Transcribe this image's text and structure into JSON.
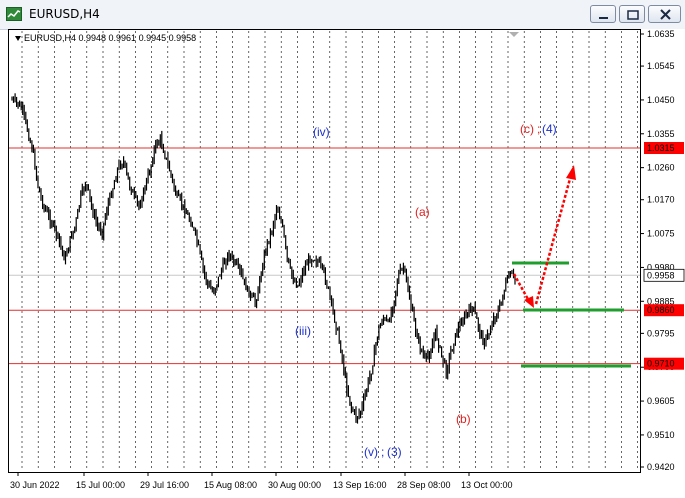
{
  "window": {
    "title": "EURUSD,H4",
    "buttons": {
      "minimize": "minimize",
      "maximize": "maximize",
      "close": "close"
    }
  },
  "header": {
    "symbol_info": "EURUSD,H4  0.9948 0.9961 0.9945 0.9958"
  },
  "price_axis": {
    "ticks": [
      "1.0635",
      "1.0545",
      "1.0450",
      "1.0355",
      "1.0260",
      "1.0170",
      "1.0075",
      "0.9980",
      "0.9885",
      "0.9795",
      "0.9700",
      "0.9605",
      "0.9510",
      "0.9420"
    ],
    "current_price": "0.9958",
    "level_markers": [
      "1.0315",
      "0.9860",
      "0.9710"
    ]
  },
  "time_axis": {
    "labels": [
      "30 Jun 2022",
      "15 Jul 00:00",
      "29 Jul 16:00",
      "15 Aug 08:00",
      "30 Aug 00:00",
      "13 Sep 16:00",
      "28 Sep 08:00",
      "13 Oct 00:00"
    ]
  },
  "wave_labels": {
    "iv": "(iv)",
    "iii": "(iii)",
    "v3_a": "(v)",
    "v3_b": ";",
    "v3_c": "(3)",
    "a": "(a)",
    "b": "(b)",
    "c4_a": "(c)",
    "c4_b": ";",
    "c4_c": "(4)"
  },
  "colors": {
    "background": "#ffffff",
    "candles": "#000000",
    "level_line": "#e03030",
    "level_marker_bg": "#ff0000",
    "target_line": "#1f9e2d",
    "projection_arrow": "#ff0000",
    "wave_blue": "#1c2fc8",
    "wave_red": "#e02020",
    "grid": "#000000"
  },
  "chart_data": {
    "type": "line",
    "title": "",
    "xlabel": "",
    "ylabel": "",
    "ylim": [
      0.94,
      1.066
    ],
    "x": [
      "30 Jun 2022",
      "15 Jul 00:00",
      "29 Jul 16:00",
      "15 Aug 08:00",
      "30 Aug 00:00",
      "13 Sep 16:00",
      "28 Sep 08:00",
      "13 Oct 00:00"
    ],
    "series": [
      {
        "values": [
          1.045,
          1.044,
          1.042,
          1.036,
          1.03,
          1.02,
          1.015,
          1.012,
          1.009,
          1.005,
          1.0,
          1.006,
          1.01,
          1.018,
          1.022,
          1.015,
          1.01,
          1.008,
          1.015,
          1.02,
          1.026,
          1.028,
          1.022,
          1.018,
          1.015,
          1.02,
          1.025,
          1.032,
          1.034,
          1.029,
          1.024,
          1.018,
          1.016,
          1.013,
          1.01,
          1.005,
          0.998,
          0.993,
          0.991,
          0.995,
          0.999,
          1.002,
          0.999,
          0.997,
          0.993,
          0.99,
          0.988,
          0.996,
          1.004,
          1.008,
          1.015,
          1.01,
          1.0,
          0.995,
          0.993,
          0.997,
          1.0,
          1.001,
          0.999,
          0.996,
          0.99,
          0.983,
          0.976,
          0.966,
          0.959,
          0.956,
          0.958,
          0.964,
          0.97,
          0.979,
          0.984,
          0.982,
          0.988,
          0.996,
          0.998,
          0.99,
          0.982,
          0.976,
          0.972,
          0.974,
          0.98,
          0.974,
          0.969,
          0.975,
          0.98,
          0.983,
          0.985,
          0.987,
          0.982,
          0.977,
          0.979,
          0.984,
          0.986,
          0.992,
          0.996,
          0.9948
        ]
      }
    ],
    "levels": [
      1.0315,
      0.986,
      0.971
    ],
    "last_price": 0.9958,
    "wave_labels": [
      "(iv)",
      "(iii)",
      "(v)",
      "(3)",
      "(a)",
      "(b)",
      "(c)",
      "(4)"
    ]
  }
}
